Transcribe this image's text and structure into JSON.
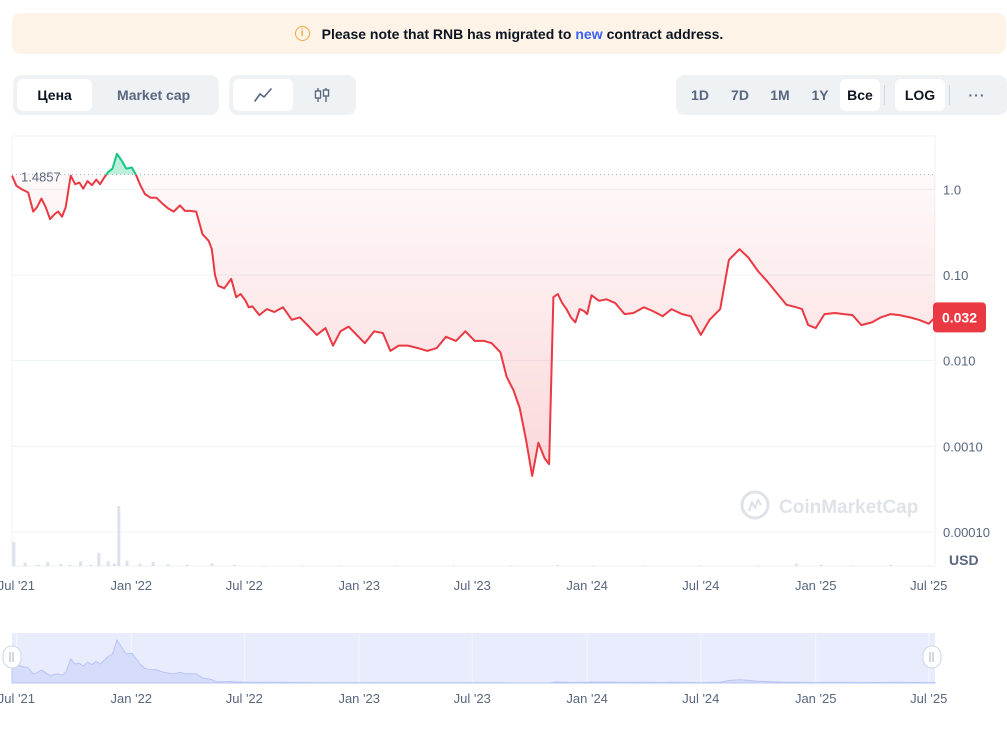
{
  "notice": {
    "before": "Please note that RNB has migrated to",
    "link": "new",
    "after": "contract address."
  },
  "tabs": {
    "metric": [
      "Цена",
      "Market cap"
    ],
    "active_metric": "Цена",
    "chart_types": [
      "line-chart-icon",
      "candlestick-icon"
    ],
    "active_chart_type": "line-chart-icon"
  },
  "ranges": [
    "1D",
    "7D",
    "1M",
    "1Y",
    "Все"
  ],
  "active_range": "Все",
  "log_label": "LOG",
  "more_label": "···",
  "colors": {
    "down": "#ea3943",
    "up": "#16c784",
    "accent": "#3861fb",
    "notice_bg": "#fdf3e6",
    "nav_fill": "#e8ecfd"
  },
  "chart_data": {
    "type": "line",
    "title": "",
    "xlabel": "",
    "ylabel": "USD",
    "y_scale": "log",
    "currency_label": "USD",
    "reference_price": 1.4857,
    "reference_label": "1.4857",
    "current_price_label": "0.032",
    "watermark": "CoinMarketCap",
    "y_ticks": [
      {
        "value": 1.0,
        "label": "1.0"
      },
      {
        "value": 0.1,
        "label": "0.10"
      },
      {
        "value": 0.01,
        "label": "0.010"
      },
      {
        "value": 0.001,
        "label": "0.0010"
      },
      {
        "value": 0.0001,
        "label": "0.00010"
      }
    ],
    "x_ticks": [
      {
        "date": "2021-07-01",
        "label": "Jul '21"
      },
      {
        "date": "2022-01-01",
        "label": "Jan '22"
      },
      {
        "date": "2022-07-01",
        "label": "Jul '22"
      },
      {
        "date": "2023-01-01",
        "label": "Jan '23"
      },
      {
        "date": "2023-07-01",
        "label": "Jul '23"
      },
      {
        "date": "2024-01-01",
        "label": "Jan '24"
      },
      {
        "date": "2024-07-01",
        "label": "Jul '24"
      },
      {
        "date": "2025-01-01",
        "label": "Jan '25"
      },
      {
        "date": "2025-07-01",
        "label": "Jul '25"
      }
    ],
    "x_range": [
      "2021-06-24",
      "2025-07-11"
    ],
    "y_range": [
      4e-05,
      4.2
    ],
    "series": [
      {
        "x": [
          "2021-06-24",
          "2021-07-01",
          "2021-07-10",
          "2021-07-20",
          "2021-07-28",
          "2021-08-03",
          "2021-08-10",
          "2021-08-17",
          "2021-08-24",
          "2021-09-01",
          "2021-09-06",
          "2021-09-12",
          "2021-09-18",
          "2021-09-26",
          "2021-10-03",
          "2021-10-10",
          "2021-10-16",
          "2021-10-23",
          "2021-10-30",
          "2021-11-06",
          "2021-11-12",
          "2021-11-18",
          "2021-11-25",
          "2021-12-02",
          "2021-12-09",
          "2021-12-16",
          "2021-12-24",
          "2022-01-02",
          "2022-01-09",
          "2022-01-16",
          "2022-01-23",
          "2022-02-01",
          "2022-02-10",
          "2022-02-20",
          "2022-03-01",
          "2022-03-10",
          "2022-03-20",
          "2022-03-28",
          "2022-04-05",
          "2022-04-15",
          "2022-04-25",
          "2022-05-05",
          "2022-05-10",
          "2022-05-15",
          "2022-05-20",
          "2022-05-30",
          "2022-06-10",
          "2022-06-18",
          "2022-06-25",
          "2022-07-03",
          "2022-07-08",
          "2022-07-14",
          "2022-07-25",
          "2022-08-06",
          "2022-08-18",
          "2022-09-01",
          "2022-09-15",
          "2022-09-28",
          "2022-10-10",
          "2022-10-25",
          "2022-11-08",
          "2022-11-20",
          "2022-12-02",
          "2022-12-15",
          "2022-12-28",
          "2023-01-10",
          "2023-01-25",
          "2023-02-08",
          "2023-02-20",
          "2023-03-05",
          "2023-03-20",
          "2023-04-05",
          "2023-04-20",
          "2023-05-05",
          "2023-05-20",
          "2023-06-05",
          "2023-06-20",
          "2023-07-05",
          "2023-07-20",
          "2023-08-01",
          "2023-08-15",
          "2023-08-25",
          "2023-09-05",
          "2023-09-15",
          "2023-09-25",
          "2023-10-05",
          "2023-10-15",
          "2023-10-25",
          "2023-11-01",
          "2023-11-08",
          "2023-11-15",
          "2023-11-22",
          "2023-11-29",
          "2023-12-06",
          "2023-12-13",
          "2023-12-20",
          "2023-12-27",
          "2024-01-01",
          "2024-01-08",
          "2024-01-20",
          "2024-02-01",
          "2024-02-15",
          "2024-03-01",
          "2024-03-15",
          "2024-04-01",
          "2024-04-15",
          "2024-05-01",
          "2024-05-15",
          "2024-06-01",
          "2024-06-15",
          "2024-07-01",
          "2024-07-15",
          "2024-08-01",
          "2024-08-15",
          "2024-09-01",
          "2024-09-15",
          "2024-10-01",
          "2024-10-15",
          "2024-11-01",
          "2024-11-15",
          "2024-12-01",
          "2024-12-10",
          "2024-12-20",
          "2025-01-01",
          "2025-01-15",
          "2025-02-01",
          "2025-02-15",
          "2025-03-01",
          "2025-03-15",
          "2025-04-01",
          "2025-04-15",
          "2025-05-01",
          "2025-05-15",
          "2025-06-01",
          "2025-06-15",
          "2025-07-01",
          "2025-07-11"
        ],
        "values": [
          1.45,
          1.1,
          1.0,
          0.92,
          0.55,
          0.62,
          0.78,
          0.62,
          0.45,
          0.52,
          0.55,
          0.48,
          0.62,
          1.45,
          1.15,
          1.2,
          1.02,
          1.25,
          1.12,
          1.3,
          1.15,
          1.35,
          1.6,
          1.75,
          2.6,
          2.2,
          1.75,
          1.8,
          1.45,
          1.1,
          0.88,
          0.8,
          0.8,
          0.68,
          0.6,
          0.55,
          0.65,
          0.56,
          0.56,
          0.55,
          0.3,
          0.25,
          0.2,
          0.1,
          0.075,
          0.07,
          0.09,
          0.055,
          0.06,
          0.05,
          0.042,
          0.043,
          0.034,
          0.04,
          0.037,
          0.042,
          0.03,
          0.032,
          0.026,
          0.02,
          0.024,
          0.015,
          0.022,
          0.025,
          0.02,
          0.016,
          0.022,
          0.021,
          0.013,
          0.015,
          0.015,
          0.014,
          0.013,
          0.014,
          0.019,
          0.017,
          0.022,
          0.017,
          0.017,
          0.016,
          0.0125,
          0.0065,
          0.0045,
          0.0028,
          0.0012,
          0.00045,
          0.0011,
          0.00072,
          0.00062,
          0.055,
          0.06,
          0.047,
          0.04,
          0.032,
          0.028,
          0.04,
          0.038,
          0.035,
          0.058,
          0.05,
          0.052,
          0.047,
          0.035,
          0.036,
          0.042,
          0.038,
          0.033,
          0.04,
          0.035,
          0.033,
          0.02,
          0.03,
          0.04,
          0.15,
          0.2,
          0.16,
          0.11,
          0.085,
          0.06,
          0.045,
          0.042,
          0.04,
          0.026,
          0.024,
          0.035,
          0.036,
          0.035,
          0.034,
          0.026,
          0.028,
          0.032,
          0.035,
          0.034,
          0.032,
          0.03,
          0.027,
          0.032
        ]
      }
    ],
    "volume": {
      "x": [
        "2021-06-27",
        "2021-07-15",
        "2021-08-05",
        "2021-08-20",
        "2021-09-10",
        "2021-09-25",
        "2021-10-12",
        "2021-10-28",
        "2021-11-10",
        "2021-11-25",
        "2021-12-05",
        "2021-12-12",
        "2021-12-25",
        "2022-01-15",
        "2022-02-05",
        "2022-03-01",
        "2022-04-01",
        "2022-05-10",
        "2022-06-15",
        "2022-08-01",
        "2022-10-01",
        "2022-12-01",
        "2023-03-01",
        "2023-06-01",
        "2023-09-01",
        "2023-11-15",
        "2024-01-10",
        "2024-04-01",
        "2024-07-01",
        "2024-10-01",
        "2024-12-01",
        "2025-01-10",
        "2025-03-01",
        "2025-05-01",
        "2025-07-01"
      ],
      "values": [
        40,
        6,
        2,
        7,
        3,
        2,
        8,
        2,
        22,
        8,
        4,
        100,
        9,
        4,
        7,
        3,
        2,
        4,
        2,
        1,
        1,
        1,
        1,
        1,
        1,
        2,
        1,
        1,
        1,
        1,
        4,
        2,
        1,
        2,
        1
      ]
    },
    "navigator_labels": [
      "Jul '21",
      "Jan '22",
      "Jul '22",
      "Jan '23",
      "Jul '23",
      "Jan '24",
      "Jul '24",
      "Jan '25",
      "Jul '25"
    ]
  }
}
